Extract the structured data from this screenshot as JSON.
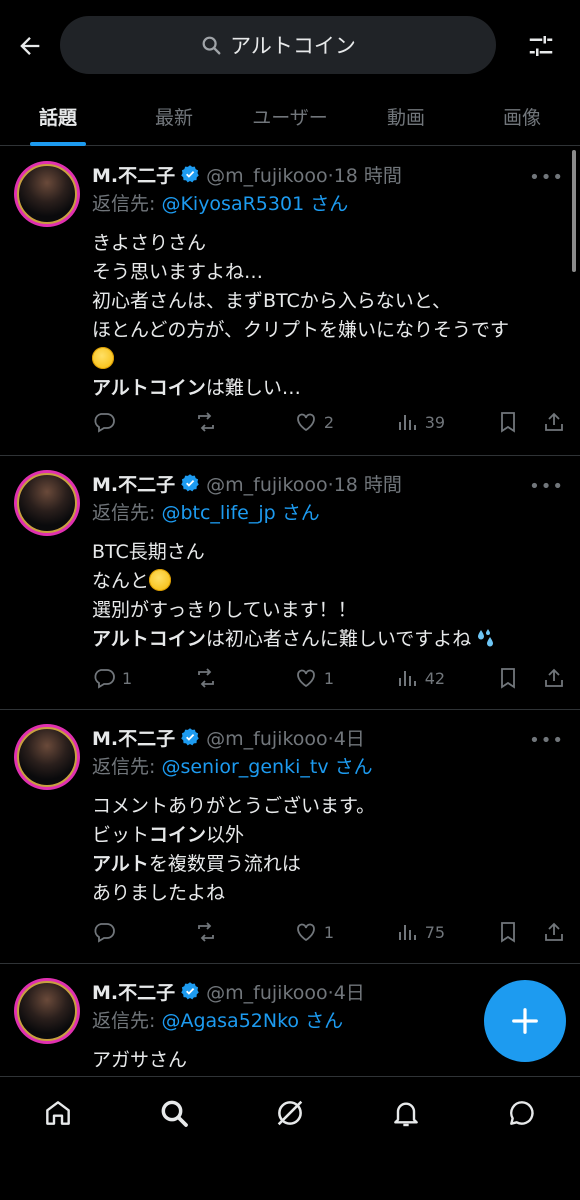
{
  "search": {
    "query": "アルトコイン"
  },
  "tabs": [
    {
      "label": "話題",
      "active": true
    },
    {
      "label": "最新",
      "active": false
    },
    {
      "label": "ユーザー",
      "active": false
    },
    {
      "label": "動画",
      "active": false
    },
    {
      "label": "画像",
      "active": false
    }
  ],
  "colors": {
    "accent": "#1d9bf0",
    "background": "#000000",
    "muted": "#71767b",
    "text": "#e7e9ea",
    "divider": "#2f3336"
  },
  "tweets": [
    {
      "name": "M.不二子",
      "handle": "@m_fujikooo",
      "dot": "·",
      "time": "18 時間",
      "reply_prefix": "返信先: ",
      "reply_handle": "@KiyosaR5301 さん",
      "lines": [
        "きよさりさん",
        "そう思いますよね…",
        "初心者さんは、まずBTCから入らないと、",
        "ほとんどの方が、クリプトを嫌いになりそうです"
      ],
      "emoji_line": "sweat-smile-emoji",
      "bold_word": "アルトコイン",
      "last_line_rest": "は難しい…",
      "stats": {
        "replies": "",
        "retweets": "",
        "likes": "2",
        "views": "39"
      }
    },
    {
      "name": "M.不二子",
      "handle": "@m_fujikooo",
      "dot": "·",
      "time": "18 時間",
      "reply_prefix": "返信先: ",
      "reply_handle": "@btc_life_jp さん",
      "line1": "BTC長期さん",
      "line2": "なんと",
      "line3": "選別がすっきりしています！！",
      "bold_word": "アルトコイン",
      "line4_rest": "は初心者さんに難しいですよね",
      "stats": {
        "replies": "1",
        "retweets": "",
        "likes": "1",
        "views": "42"
      }
    },
    {
      "name": "M.不二子",
      "handle": "@m_fujikooo",
      "dot": "·",
      "time": "4日",
      "reply_prefix": "返信先: ",
      "reply_handle": "@senior_genki_tv さん",
      "line1": "コメントありがとうございます。",
      "line2_pre": "ビット",
      "line2_bold": "コイン",
      "line2_post": "以外",
      "line3_bold": "アルト",
      "line3_post": "を複数買う流れは",
      "line4": "ありましたよね",
      "stats": {
        "replies": "",
        "retweets": "",
        "likes": "1",
        "views": "75"
      }
    },
    {
      "name": "M.不二子",
      "handle": "@m_fujikooo",
      "dot": "·",
      "time": "4日",
      "reply_prefix": "返信先: ",
      "reply_handle": "@Agasa52Nko さん",
      "line1": "アガサさん"
    }
  ],
  "more_label": "•••"
}
